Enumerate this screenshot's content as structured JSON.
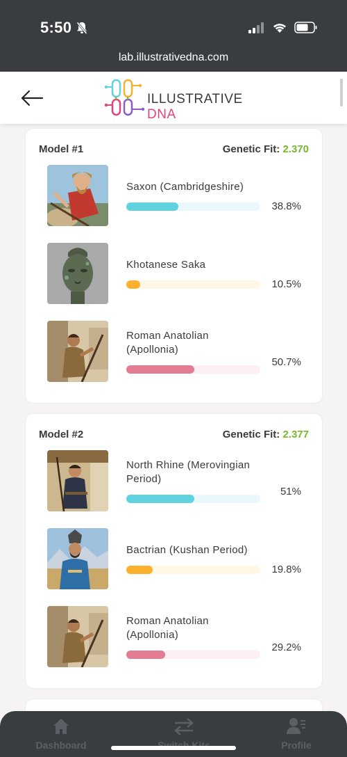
{
  "status_bar": {
    "time": "5:50",
    "url": "lab.illustrativedna.com"
  },
  "header": {
    "logo_text_main": "ILLUSTRATIVE ",
    "logo_text_accent": "DNA"
  },
  "colors": {
    "fit_value": "#76b82a",
    "bar_cyan": "#5fd3e0",
    "bar_orange": "#fbb12e",
    "bar_pink": "#e37b91"
  },
  "models": [
    {
      "label": "Model #1",
      "fit_label": "Genetic Fit:",
      "fit_value": "2.370",
      "rows": [
        {
          "name": "Saxon (Cambridgeshire)",
          "percent": "38.8%",
          "value": 38.8,
          "color": "cyan",
          "image": "saxon-warrior-image"
        },
        {
          "name": "Khotanese Saka",
          "percent": "10.5%",
          "value": 10.5,
          "color": "orange",
          "image": "bronze-head-image"
        },
        {
          "name": "Roman Anatolian (Apollonia)",
          "percent": "50.7%",
          "value": 50.7,
          "color": "pink",
          "image": "roman-worker-image"
        }
      ]
    },
    {
      "label": "Model #2",
      "fit_label": "Genetic Fit:",
      "fit_value": "2.377",
      "rows": [
        {
          "name": "North Rhine (Merovingian Period)",
          "percent": "51%",
          "value": 51,
          "color": "cyan",
          "image": "merovingian-man-image"
        },
        {
          "name": "Bactrian (Kushan Period)",
          "percent": "19.8%",
          "value": 19.8,
          "color": "orange",
          "image": "bactrian-man-image"
        },
        {
          "name": "Roman Anatolian (Apollonia)",
          "percent": "29.2%",
          "value": 29.2,
          "color": "pink",
          "image": "roman-worker-image"
        }
      ]
    }
  ],
  "bottom_nav": {
    "dashboard": "Dashboard",
    "switch_kits": "Switch Kits",
    "profile": "Profile"
  }
}
